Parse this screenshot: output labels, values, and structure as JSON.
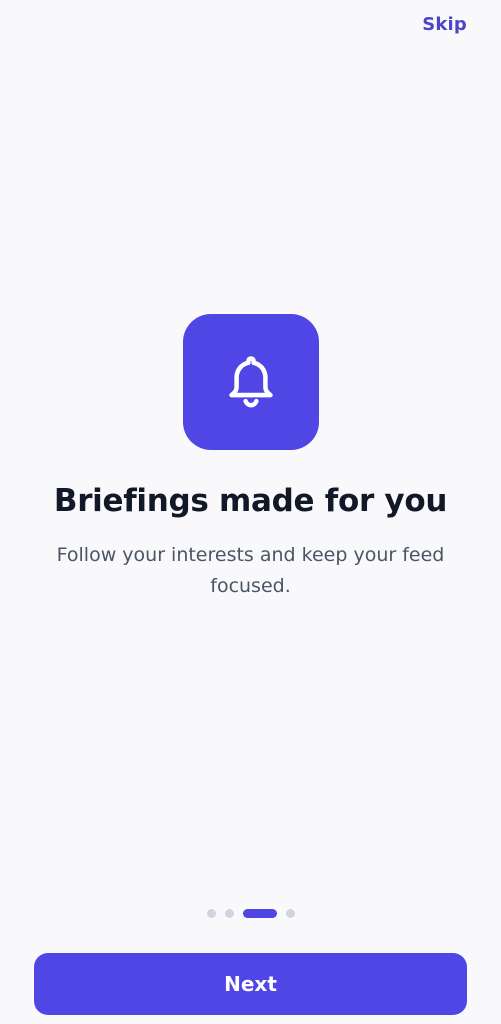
{
  "header": {
    "skip_label": "Skip"
  },
  "hero": {
    "icon": "bell-icon",
    "title": "Briefings made for you",
    "subtitle": "Follow your interests and keep your feed focused."
  },
  "pager": {
    "total_pages": 4,
    "current_page": 3
  },
  "footer": {
    "next_label": "Next"
  },
  "colors": {
    "accent": "#4f46e5",
    "link": "#4a45c9",
    "background": "#f9f9fb",
    "title": "#111827",
    "body_text": "#4b5563",
    "dot_inactive": "#cfd5df"
  }
}
